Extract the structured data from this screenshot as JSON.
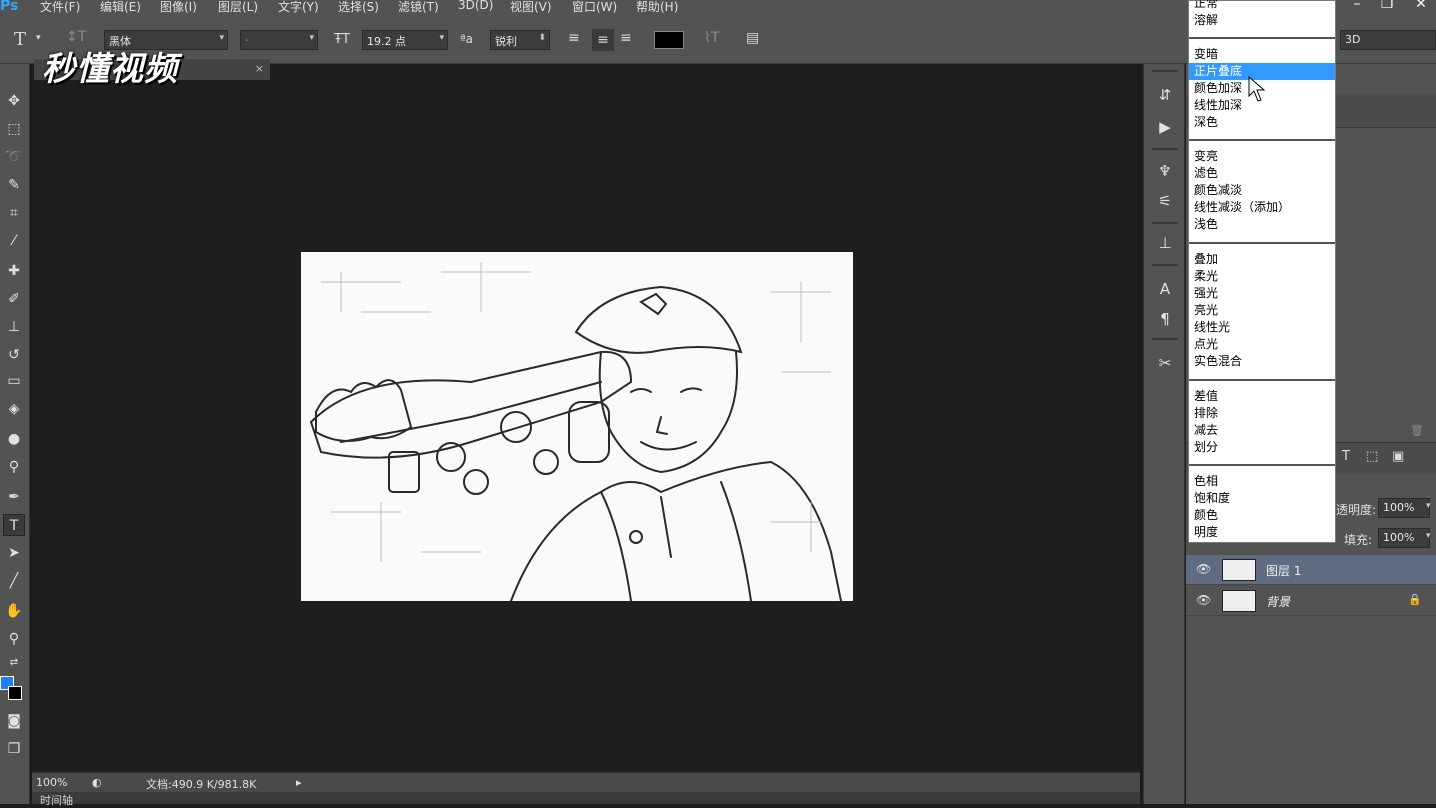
{
  "app": {
    "logo": "Ps"
  },
  "menubar": {
    "items": [
      "文件(F)",
      "编辑(E)",
      "图像(I)",
      "图层(L)",
      "文字(Y)",
      "选择(S)",
      "滤镜(T)",
      "3D(D)",
      "视图(V)",
      "窗口(W)",
      "帮助(H)"
    ]
  },
  "window_controls": {
    "minimize": "–",
    "restore": "❐",
    "close": "✕"
  },
  "options": {
    "tool_icon": "T",
    "orient_icon": "↕T",
    "font_family": "黑体",
    "font_style": "-",
    "font_size": "19.2 点",
    "antialias": "锐利",
    "color": "#000000",
    "workspace": "3D"
  },
  "watermark": "秒懂视频",
  "document": {
    "tab_close": "×"
  },
  "statusbar": {
    "zoom": "100%",
    "doc_info": "文档:490.9 K/981.8K",
    "arrow": "▸"
  },
  "timeline": {
    "label": "时间轴"
  },
  "blend_modes": {
    "groups": [
      [
        "正常",
        "溶解"
      ],
      [
        "变暗",
        "正片叠底",
        "颜色加深",
        "线性加深",
        "深色"
      ],
      [
        "变亮",
        "滤色",
        "颜色减淡",
        "线性减淡（添加）",
        "浅色"
      ],
      [
        "叠加",
        "柔光",
        "强光",
        "亮光",
        "线性光",
        "点光",
        "实色混合"
      ],
      [
        "差值",
        "排除",
        "减去",
        "划分"
      ],
      [
        "色相",
        "饱和度",
        "颜色",
        "明度"
      ]
    ],
    "selected": "正片叠底"
  },
  "layers_panel": {
    "opacity_label": "透明度:",
    "opacity_value": "100%",
    "fill_label": "填充:",
    "fill_value": "100%",
    "layers": [
      {
        "name": "图层 1",
        "selected": true
      },
      {
        "name": "背景",
        "selected": false
      }
    ]
  },
  "colors": {
    "foreground": "#1f7fff",
    "background": "#000000",
    "accent": "#3399ff"
  }
}
